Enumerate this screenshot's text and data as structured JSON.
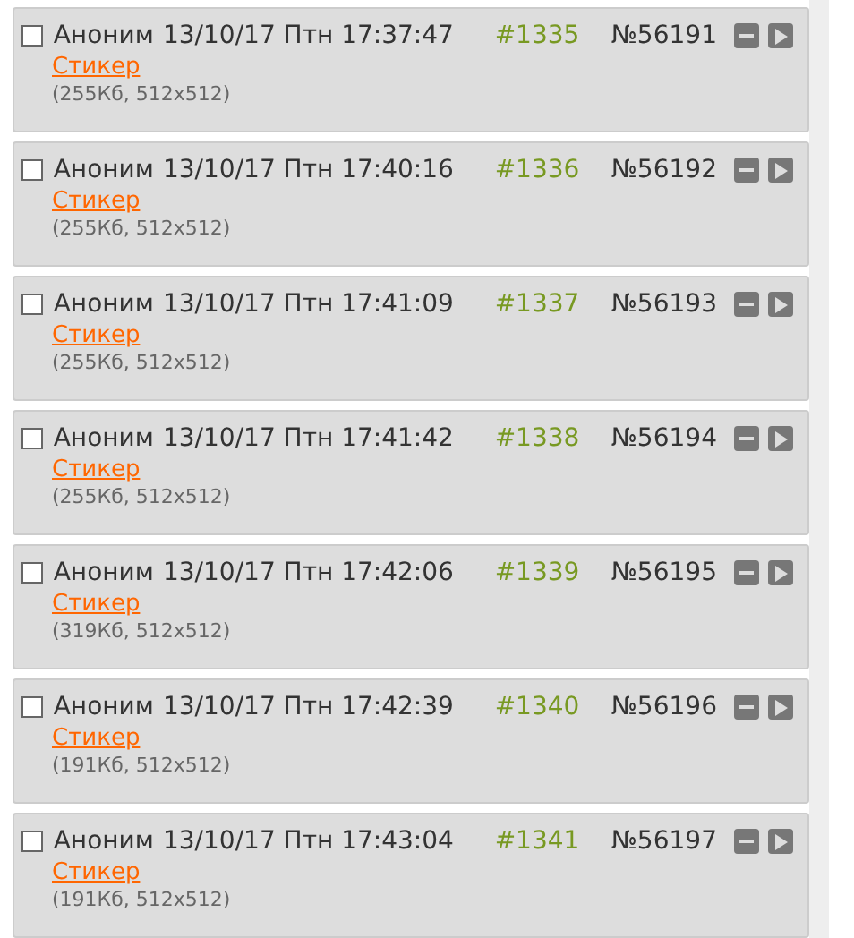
{
  "posts": [
    {
      "checked": false,
      "author": "Аноним",
      "date": "13/10/17 Птн 17:37:47",
      "index": "#1335",
      "number": "№56191",
      "file_link": "Стикер",
      "file_info": "(255Кб, 512x512)"
    },
    {
      "checked": false,
      "author": "Аноним",
      "date": "13/10/17 Птн 17:40:16",
      "index": "#1336",
      "number": "№56192",
      "file_link": "Стикер",
      "file_info": "(255Кб, 512x512)"
    },
    {
      "checked": false,
      "author": "Аноним",
      "date": "13/10/17 Птн 17:41:09",
      "index": "#1337",
      "number": "№56193",
      "file_link": "Стикер",
      "file_info": "(255Кб, 512x512)"
    },
    {
      "checked": false,
      "author": "Аноним",
      "date": "13/10/17 Птн 17:41:42",
      "index": "#1338",
      "number": "№56194",
      "file_link": "Стикер",
      "file_info": "(255Кб, 512x512)"
    },
    {
      "checked": false,
      "author": "Аноним",
      "date": "13/10/17 Птн 17:42:06",
      "index": "#1339",
      "number": "№56195",
      "file_link": "Стикер",
      "file_info": "(319Кб, 512x512)"
    },
    {
      "checked": false,
      "author": "Аноним",
      "date": "13/10/17 Птн 17:42:39",
      "index": "#1340",
      "number": "№56196",
      "file_link": "Стикер",
      "file_info": "(191Кб, 512x512)"
    },
    {
      "checked": false,
      "author": "Аноним",
      "date": "13/10/17 Птн 17:43:04",
      "index": "#1341",
      "number": "№56197",
      "file_link": "Стикер",
      "file_info": "(191Кб, 512x512)"
    }
  ]
}
